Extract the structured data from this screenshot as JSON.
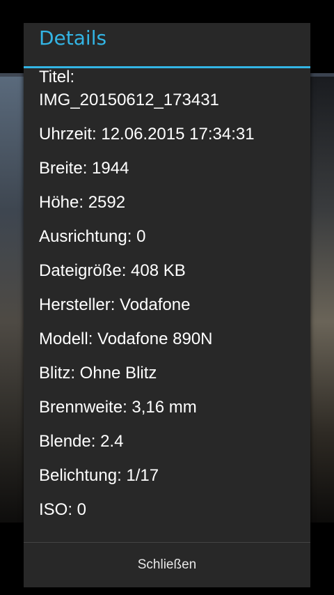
{
  "dialog": {
    "title": "Details",
    "close_label": "Schließen"
  },
  "details": {
    "title_label": "Titel:",
    "title_value": "IMG_20150612_173431",
    "time": "Uhrzeit: 12.06.2015 17:34:31",
    "width": "Breite: 1944",
    "height": "Höhe: 2592",
    "orientation": "Ausrichtung: 0",
    "file_size": "Dateigröße: 408 KB",
    "manufacturer": "Hersteller: Vodafone",
    "model": "Modell: Vodafone 890N",
    "flash": "Blitz: Ohne Blitz",
    "focal_length": "Brennweite: 3,16 mm",
    "aperture": "Blende: 2.4",
    "exposure": "Belichtung: 1/17",
    "iso": "ISO: 0"
  },
  "colors": {
    "accent": "#33b5e5",
    "dialog_background": "#282828",
    "text": "#ffffff"
  }
}
